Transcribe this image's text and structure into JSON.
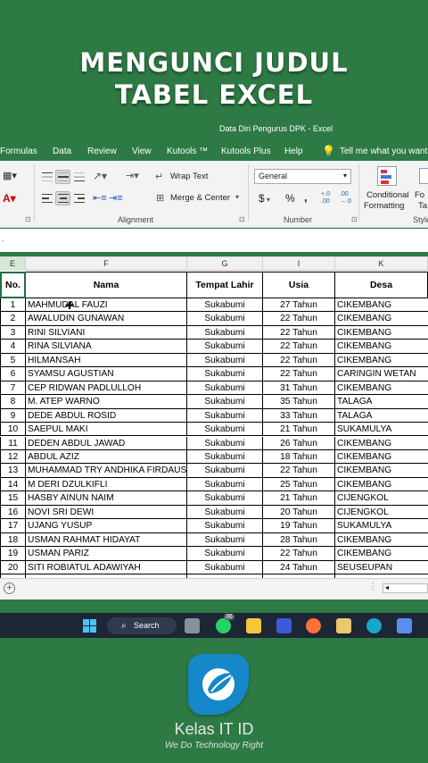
{
  "headline": [
    "MENGUNCI JUDUL",
    "TABEL EXCEL"
  ],
  "window_title": "Data Diri Pengurus DPK  -  Excel",
  "menu": [
    "Formulas",
    "Data",
    "Review",
    "View",
    "Kutools ™",
    "Kutools Plus",
    "Help"
  ],
  "tell_me": "Tell me what you want to do",
  "ribbon": {
    "wrap_text": "Wrap Text",
    "merge_center": "Merge & Center",
    "alignment_label": "Alignment",
    "number_format": "General",
    "currency": "$",
    "percent": "%",
    "comma": ",",
    "inc_decimal": "+.0\n.00",
    "number_label": "Number",
    "conditional": "Conditional",
    "formatting": "Formatting",
    "format_as": "Fo",
    "table_short": "Ta",
    "styles_label": "Style"
  },
  "columns": [
    "E",
    "F",
    "G",
    "I",
    "K"
  ],
  "headers": {
    "no": "No.",
    "nama": "Nama",
    "tempat_lahir": "Tempat Lahir",
    "usia": "Usia",
    "desa": "Desa"
  },
  "rows": [
    {
      "no": "1",
      "nama": "MAHMUDAL FAUZI",
      "tl": "Sukabumi",
      "usia": "27 Tahun",
      "desa": "CIKEMBANG"
    },
    {
      "no": "2",
      "nama": "AWALUDIN GUNAWAN",
      "tl": "Sukabumi",
      "usia": "22 Tahun",
      "desa": "CIKEMBANG"
    },
    {
      "no": "3",
      "nama": "RINI SILVIANI",
      "tl": "Sukabumi",
      "usia": "22 Tahun",
      "desa": "CIKEMBANG"
    },
    {
      "no": "4",
      "nama": "RINA SILVIANA",
      "tl": "Sukabumi",
      "usia": "22 Tahun",
      "desa": "CIKEMBANG"
    },
    {
      "no": "5",
      "nama": "HILMANSAH",
      "tl": "Sukabumi",
      "usia": "22 Tahun",
      "desa": "CIKEMBANG"
    },
    {
      "no": "6",
      "nama": "SYAMSU AGUSTIAN",
      "tl": "Sukabumi",
      "usia": "22 Tahun",
      "desa": "CARINGIN WETAN"
    },
    {
      "no": "7",
      "nama": "CEP RIDWAN PADLULLOH",
      "tl": "Sukabumi",
      "usia": "31 Tahun",
      "desa": "CIKEMBANG"
    },
    {
      "no": "8",
      "nama": "M. ATEP WARNO",
      "tl": "Sukabumi",
      "usia": "35 Tahun",
      "desa": "TALAGA"
    },
    {
      "no": "9",
      "nama": "DEDE ABDUL ROSID",
      "tl": "Sukabumi",
      "usia": "33 Tahun",
      "desa": "TALAGA"
    },
    {
      "no": "10",
      "nama": "SAEPUL MAKI",
      "tl": "Sukabumi",
      "usia": "21 Tahun",
      "desa": "SUKAMULYA"
    },
    {
      "no": "11",
      "nama": "DEDEN ABDUL JAWAD",
      "tl": "Sukabumi",
      "usia": "26 Tahun",
      "desa": "CIKEMBANG"
    },
    {
      "no": "12",
      "nama": "ABDUL AZIZ",
      "tl": "Sukabumi",
      "usia": "18 Tahun",
      "desa": "CIKEMBANG"
    },
    {
      "no": "13",
      "nama": "MUHAMMAD TRY ANDHIKA FIRDAUS",
      "tl": "Sukabumi",
      "usia": "22 Tahun",
      "desa": "CIKEMBANG"
    },
    {
      "no": "14",
      "nama": "M DERI DZULKIFLI",
      "tl": "Sukabumi",
      "usia": "25 Tahun",
      "desa": "CIKEMBANG"
    },
    {
      "no": "15",
      "nama": "HASBY AINUN NAIM",
      "tl": "Sukabumi",
      "usia": "21 Tahun",
      "desa": "CIJENGKOL"
    },
    {
      "no": "16",
      "nama": "NOVI SRI DEWI",
      "tl": "Sukabumi",
      "usia": "20 Tahun",
      "desa": "CIJENGKOL"
    },
    {
      "no": "17",
      "nama": "UJANG YUSUP",
      "tl": "Sukabumi",
      "usia": "19 Tahun",
      "desa": "SUKAMULYA"
    },
    {
      "no": "18",
      "nama": "USMAN RAHMAT HIDAYAT",
      "tl": "Sukabumi",
      "usia": "28 Tahun",
      "desa": "CIKEMBANG"
    },
    {
      "no": "19",
      "nama": "USMAN PARIZ",
      "tl": "Sukabumi",
      "usia": "22 Tahun",
      "desa": "CIKEMBANG"
    },
    {
      "no": "20",
      "nama": "SITI ROBIATUL ADAWIYAH",
      "tl": "Sukabumi",
      "usia": "24 Tahun",
      "desa": "SEUSEUPAN"
    }
  ],
  "taskbar": {
    "search": "Search",
    "badge": "36"
  },
  "brand": {
    "name": "Kelas IT ID",
    "tagline": "We Do Technology Right"
  },
  "colors": {
    "background": "#2d7a44",
    "excel_green": "#1f7145",
    "logo_blue": "#1687c9",
    "taskbar": "#1d2634"
  }
}
